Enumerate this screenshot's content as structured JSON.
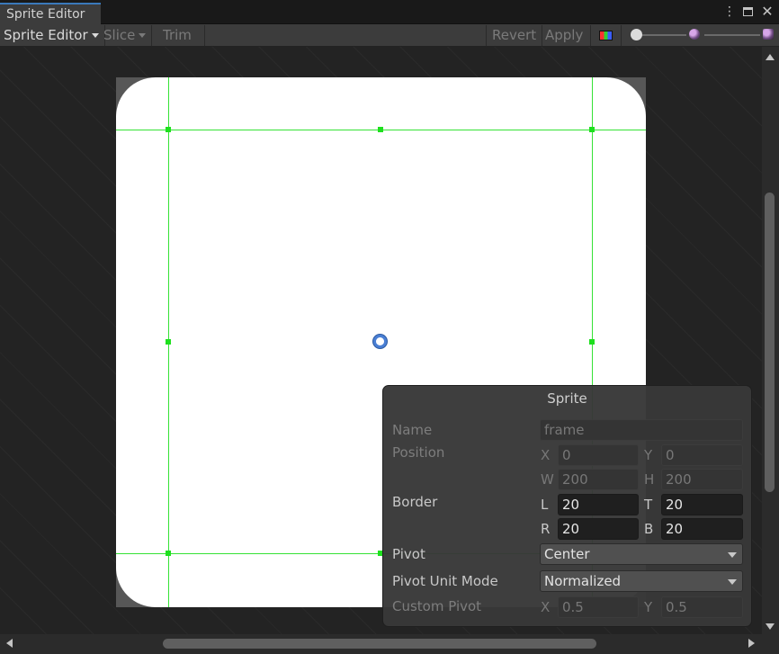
{
  "window": {
    "tab_title": "Sprite Editor",
    "menu_glyph": "⋮",
    "close_glyph": "✕"
  },
  "toolbar": {
    "editor_mode": "Sprite Editor",
    "slice_label": "Slice",
    "trim_label": "Trim",
    "revert_label": "Revert",
    "apply_label": "Apply",
    "color_channel_icon": "rgb-channels-icon",
    "zoom_slider_level": 0.0,
    "mip_slider_level": 1.0
  },
  "colors": {
    "accent": "#3a79bb",
    "guide": "#35e235",
    "pivot": "#4a7fd4"
  },
  "sprite_panel": {
    "title": "Sprite",
    "name_label": "Name",
    "name_value": "frame",
    "position_label": "Position",
    "x_label": "X",
    "x_value": "0",
    "y_label": "Y",
    "y_value": "0",
    "w_label": "W",
    "w_value": "200",
    "h_label": "H",
    "h_value": "200",
    "border_label": "Border",
    "l_label": "L",
    "l_value": "20",
    "t_label": "T",
    "t_value": "20",
    "r_label": "R",
    "r_value": "20",
    "b_label": "B",
    "b_value": "20",
    "pivot_label": "Pivot",
    "pivot_value": "Center",
    "pivot_unit_label": "Pivot Unit Mode",
    "pivot_unit_value": "Normalized",
    "custom_pivot_label": "Custom Pivot",
    "cp_x_label": "X",
    "cp_x_value": "0.5",
    "cp_y_label": "Y",
    "cp_y_value": "0.5"
  }
}
